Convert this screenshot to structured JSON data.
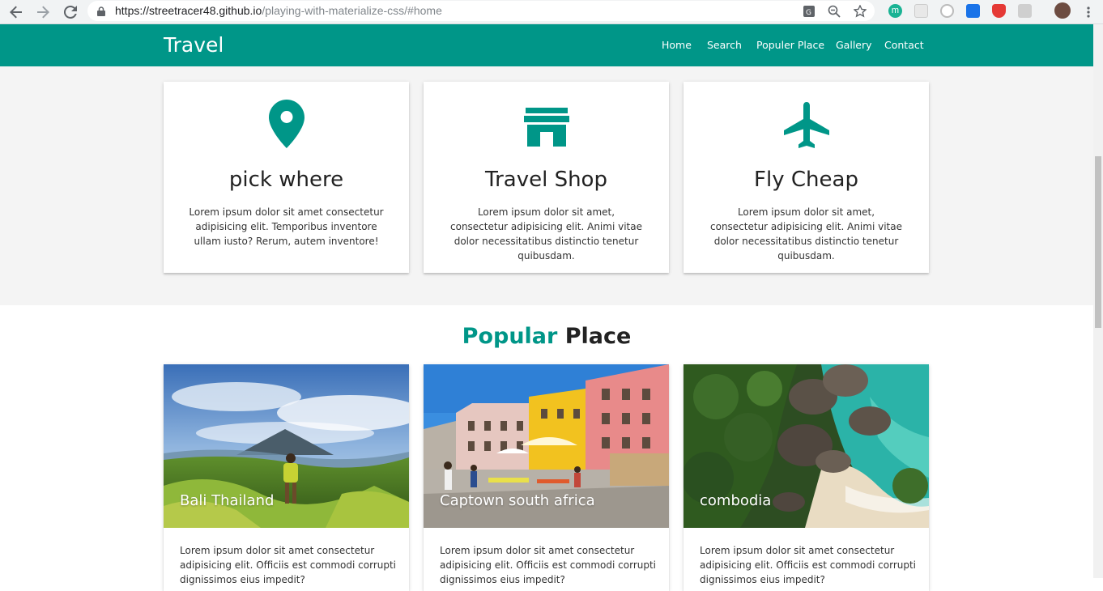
{
  "browser": {
    "url_host": "https://streetracer48.github.io",
    "url_path": "/playing-with-materialize-css/#home",
    "extension_m_label": "m"
  },
  "navbar": {
    "brand": "Travel",
    "links": [
      "Home",
      "Search",
      "Populer Place",
      "Gallery",
      "Contact"
    ]
  },
  "features": [
    {
      "icon": "location-pin-icon",
      "title": "pick where",
      "text": "Lorem ipsum dolor sit amet consectetur adipisicing elit. Temporibus inventore ullam iusto? Rerum, autem inventore!"
    },
    {
      "icon": "store-icon",
      "title": "Travel Shop",
      "text": "Lorem ipsum dolor sit amet, consectetur adipisicing elit. Animi vitae dolor necessitatibus distinctio tenetur quibusdam."
    },
    {
      "icon": "airplane-icon",
      "title": "Fly Cheap",
      "text": "Lorem ipsum dolor sit amet, consectetur adipisicing elit. Animi vitae dolor necessitatibus distinctio tenetur quibusdam."
    }
  ],
  "popular": {
    "title_accent": "Popular",
    "title_rest": "Place",
    "places": [
      {
        "name": "Bali Thailand",
        "text": "Lorem ipsum dolor sit amet consectetur adipisicing elit. Officiis est commodi corrupti dignissimos eius impedit?"
      },
      {
        "name": "Captown south africa",
        "text": "Lorem ipsum dolor sit amet consectetur adipisicing elit. Officiis est commodi corrupti dignissimos eius impedit?"
      },
      {
        "name": "combodia",
        "text": "Lorem ipsum dolor sit amet consectetur adipisicing elit. Officiis est commodi corrupti dignissimos eius impedit?"
      }
    ]
  },
  "colors": {
    "primary": "#009688",
    "page_grey": "#f4f4f4"
  }
}
